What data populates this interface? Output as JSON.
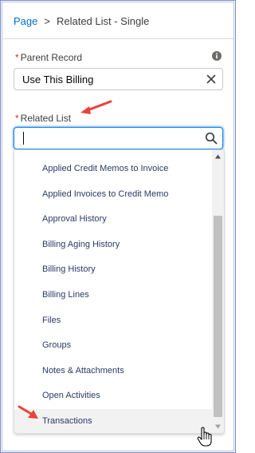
{
  "breadcrumb": {
    "root": "Page",
    "separator": ">",
    "current": "Related List - Single"
  },
  "parent_record": {
    "required_marker": "*",
    "label": "Parent Record",
    "value": "Use This Billing"
  },
  "related_list": {
    "required_marker": "*",
    "label": "Related List",
    "value": ""
  },
  "dropdown": {
    "options": [
      "Applied Credit Memos to Invoice",
      "Applied Invoices to Credit Memo",
      "Approval History",
      "Billing Aging History",
      "Billing History",
      "Billing Lines",
      "Files",
      "Groups",
      "Notes & Attachments",
      "Open Activities",
      "Transactions"
    ],
    "highlighted_index": 10,
    "scroll_thumb_fraction": 0.7
  },
  "colors": {
    "link": "#006dcc",
    "required": "#c23934",
    "focus": "#1589ee",
    "annotation_arrow": "#e8433a",
    "option_text": "#2b3a67"
  }
}
